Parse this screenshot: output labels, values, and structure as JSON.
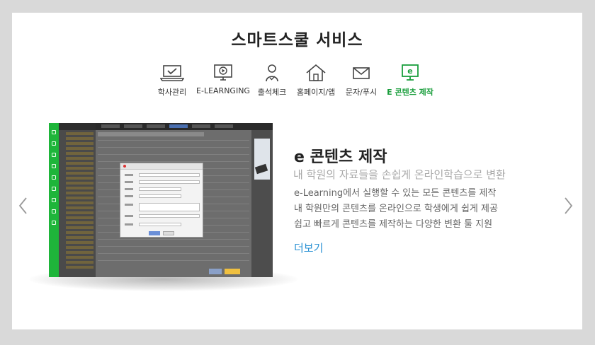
{
  "section": {
    "title": "스마트스쿨 서비스"
  },
  "tabs": [
    {
      "label": "학사관리",
      "icon": "laptop-check-icon",
      "active": false
    },
    {
      "label": "E-LEARNGING",
      "icon": "monitor-play-icon",
      "active": false
    },
    {
      "label": "출석체크",
      "icon": "person-check-icon",
      "active": false
    },
    {
      "label": "홈페이지/앱",
      "icon": "home-icon",
      "active": false
    },
    {
      "label": "문자/푸시",
      "icon": "envelope-icon",
      "active": false
    },
    {
      "label": "E 콘텐츠 제작",
      "icon": "monitor-e-icon",
      "active": true
    }
  ],
  "slide": {
    "heading": "e 콘텐츠 제작",
    "subheading": "내 학원의 자료들을 손쉽게 온라인학습으로 변환",
    "lines": [
      "e-Learning에서 실행할 수 있는 모든 콘텐츠를 제작",
      "내 학원만의 콘텐츠를 온라인으로 학생에게 쉽게 제공",
      "쉽고 빠르게 콘텐츠를 제작하는 다양한 변환 툴 지원"
    ],
    "more_link": "더보기"
  },
  "colors": {
    "accent_green": "#1a9e3c",
    "link_blue": "#2b92d4",
    "background": "#d9d9d9"
  }
}
